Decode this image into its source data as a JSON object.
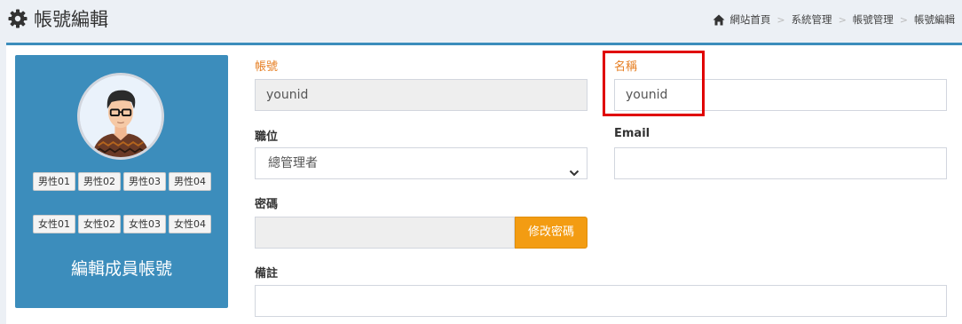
{
  "header": {
    "title": "帳號編輯",
    "title_icon": "gear-icon"
  },
  "breadcrumb": {
    "items": [
      "網站首頁",
      "系統管理",
      "帳號管理",
      "帳號編輯"
    ],
    "separator": ">"
  },
  "profile": {
    "male_tags": [
      "男性01",
      "男性02",
      "男性03",
      "男性04"
    ],
    "female_tags": [
      "女性01",
      "女性02",
      "女性03",
      "女性04"
    ],
    "caption": "編輯成員帳號"
  },
  "form": {
    "account": {
      "label": "帳號",
      "value": "younid"
    },
    "name": {
      "label": "名稱",
      "value": "younid"
    },
    "position": {
      "label": "職位",
      "selected": "總管理者"
    },
    "email": {
      "label": "Email",
      "value": ""
    },
    "password": {
      "label": "密碼",
      "value": "",
      "button": "修改密碼"
    },
    "note": {
      "label": "備註",
      "value": ""
    }
  },
  "colors": {
    "accent": "#3c8dbc",
    "label_orange": "#e67e22",
    "button_orange": "#f39c12",
    "highlight_red": "#e00000"
  }
}
